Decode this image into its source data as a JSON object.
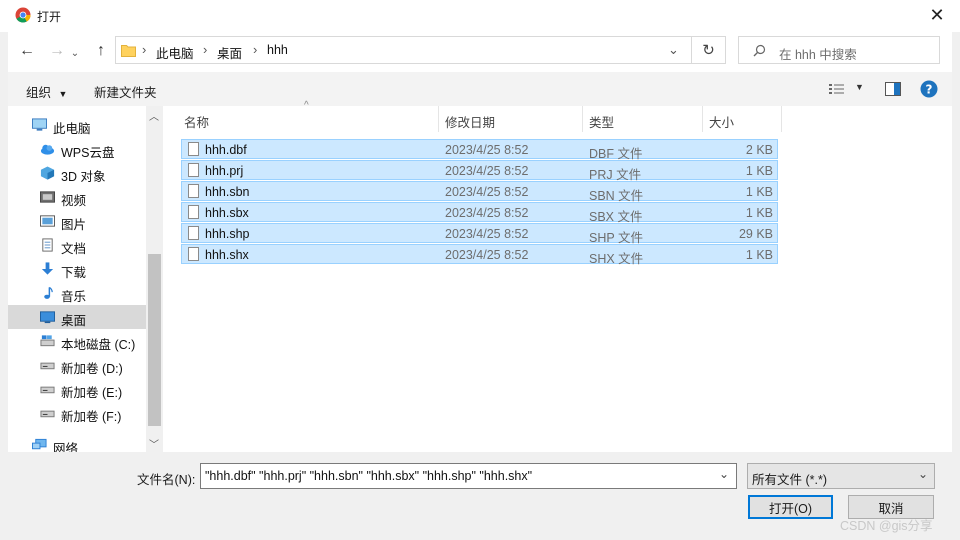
{
  "window": {
    "title": "打开"
  },
  "address": {
    "breadcrumbs": [
      "此电脑",
      "桌面",
      "hhh"
    ]
  },
  "search": {
    "placeholder": "在 hhh 中搜索"
  },
  "toolbar": {
    "organize_label": "组织",
    "new_folder_label": "新建文件夹"
  },
  "nav": {
    "items": [
      {
        "label": "此电脑",
        "icon": "computer-icon"
      },
      {
        "label": "WPS云盘",
        "icon": "cloud-icon"
      },
      {
        "label": "3D 对象",
        "icon": "cube-icon"
      },
      {
        "label": "视频",
        "icon": "video-icon"
      },
      {
        "label": "图片",
        "icon": "picture-icon"
      },
      {
        "label": "文档",
        "icon": "document-icon"
      },
      {
        "label": "下载",
        "icon": "download-icon"
      },
      {
        "label": "音乐",
        "icon": "music-icon"
      },
      {
        "label": "桌面",
        "icon": "desktop-icon",
        "selected": true
      },
      {
        "label": "本地磁盘 (C:)",
        "icon": "drive-icon"
      },
      {
        "label": "新加卷 (D:)",
        "icon": "drive-icon"
      },
      {
        "label": "新加卷 (E:)",
        "icon": "drive-icon"
      },
      {
        "label": "新加卷 (F:)",
        "icon": "drive-icon"
      },
      {
        "label": "网络",
        "icon": "network-icon"
      }
    ]
  },
  "files": {
    "columns": [
      "名称",
      "修改日期",
      "类型",
      "大小"
    ],
    "rows": [
      {
        "name": "hhh.dbf",
        "date": "2023/4/25 8:52",
        "type": "DBF 文件",
        "size": "2 KB"
      },
      {
        "name": "hhh.prj",
        "date": "2023/4/25 8:52",
        "type": "PRJ 文件",
        "size": "1 KB"
      },
      {
        "name": "hhh.sbn",
        "date": "2023/4/25 8:52",
        "type": "SBN 文件",
        "size": "1 KB"
      },
      {
        "name": "hhh.sbx",
        "date": "2023/4/25 8:52",
        "type": "SBX 文件",
        "size": "1 KB"
      },
      {
        "name": "hhh.shp",
        "date": "2023/4/25 8:52",
        "type": "SHP 文件",
        "size": "29 KB"
      },
      {
        "name": "hhh.shx",
        "date": "2023/4/25 8:52",
        "type": "SHX 文件",
        "size": "1 KB"
      }
    ]
  },
  "footer": {
    "filename_label": "文件名(N):",
    "filename_value": "\"hhh.dbf\" \"hhh.prj\" \"hhh.sbn\" \"hhh.sbx\" \"hhh.shp\" \"hhh.shx\"",
    "filetype_value": "所有文件 (*.*)",
    "open_label": "打开(O)",
    "cancel_label": "取消"
  },
  "watermark": "CSDN @gis分享",
  "colors": {
    "selection": "#cce8ff",
    "selection_border": "#99d1ff",
    "accent": "#0078d7",
    "help": "#1e73be"
  }
}
